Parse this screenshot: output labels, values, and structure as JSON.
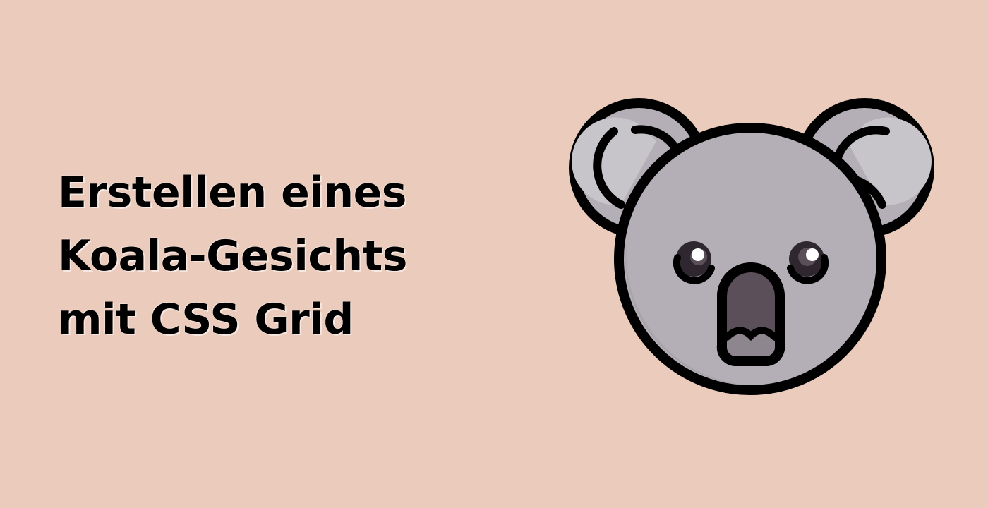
{
  "banner": {
    "title_lines": [
      "Erstellen eines",
      "Koala-Gesichts",
      "mit CSS Grid"
    ]
  },
  "illustration": {
    "icon": "koala-face-icon"
  },
  "colors": {
    "background": "#EACBBC",
    "text": "#000000",
    "outline": "#000000",
    "ear_outer": "#B4AFB6",
    "ear_inner": "#C8C5CA",
    "face": "#B4AFB6",
    "face_shade": "#A9A4AB",
    "eye": "#2E272F",
    "pupil_ring": "#5A4F59",
    "eye_shine": "#FFFFFF",
    "nose": "#5B505A",
    "mouth": "#8E868F"
  }
}
